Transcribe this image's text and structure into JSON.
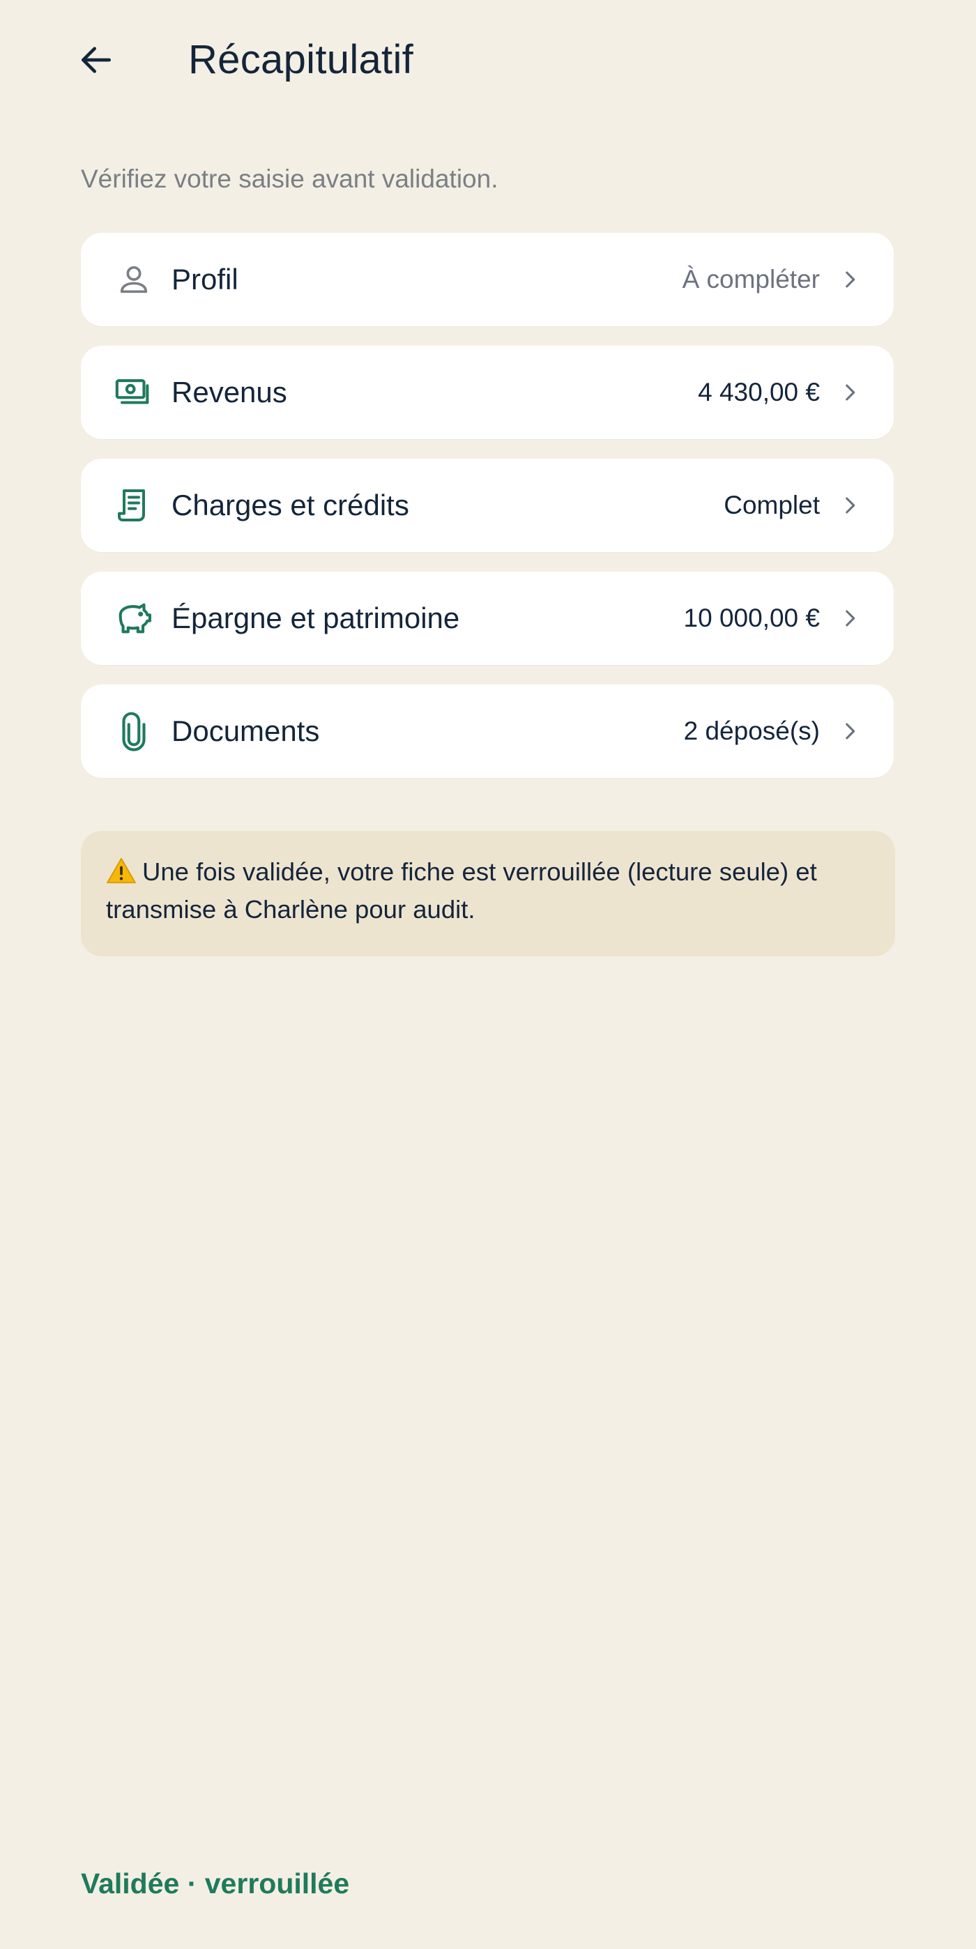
{
  "header": {
    "back_label": "",
    "title": "Récapitulatif"
  },
  "subtitle": "Vérifiez votre saisie avant validation.",
  "sections": [
    {
      "icon": "person-icon",
      "label": "Profil",
      "value": "À compléter",
      "value_style": "muted"
    },
    {
      "icon": "banknote-icon",
      "label": "Revenus",
      "value": "4 430,00 €",
      "value_style": "normal"
    },
    {
      "icon": "receipt-icon",
      "label": "Charges et crédits",
      "value": "Complet",
      "value_style": "normal"
    },
    {
      "icon": "piggy-bank-icon",
      "label": "Épargne et patrimoine",
      "value": "10 000,00 €",
      "value_style": "normal"
    },
    {
      "icon": "paperclip-icon",
      "label": "Documents",
      "value": "2 déposé(s)",
      "value_style": "normal"
    }
  ],
  "warning": {
    "icon": "warning-icon",
    "text": "Une fois validée, votre fiche est verrouillée (lecture seule) et transmise à Charlène pour audit."
  },
  "footer": {
    "status": "Validée · verrouillée"
  },
  "colors": {
    "background": "#F4EFE4",
    "card": "#FFFFFF",
    "accent_green": "#1F7A5C",
    "text_dark": "#14253A",
    "text_muted": "#7A7F86",
    "warning_bg": "#EDE4D0"
  }
}
